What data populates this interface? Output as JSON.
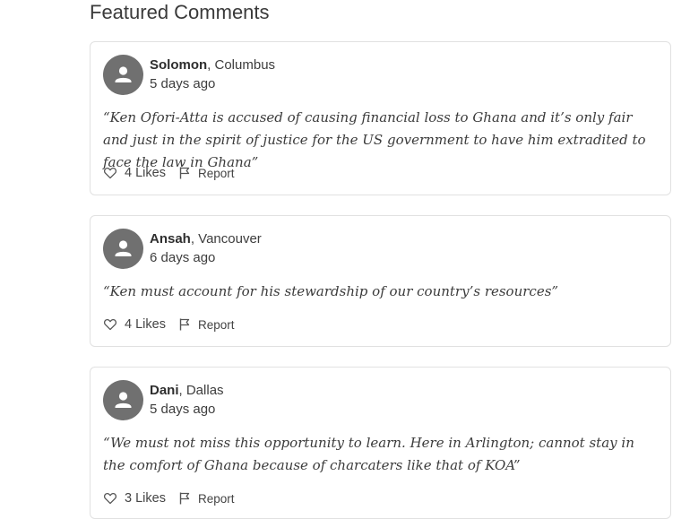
{
  "section": {
    "title": "Featured Comments"
  },
  "comments": [
    {
      "author": "Solomon",
      "location": ", Columbus",
      "time": "5 days ago",
      "text": "“Ken Ofori-Atta is accused of causing financial loss to Ghana and it’s only fair and just in the spirit of justice for the US government to have him extradited to face the law in Ghana”",
      "likes_label": "4 Likes",
      "report_label": "Report"
    },
    {
      "author": "Ansah",
      "location": ", Vancouver",
      "time": "6 days ago",
      "text": "“Ken must account for his stewardship of our country’s resources”",
      "likes_label": "4 Likes",
      "report_label": "Report"
    },
    {
      "author": "Dani",
      "location": ", Dallas",
      "time": "5 days ago",
      "text": "“We must not miss this opportunity to learn. Here in Arlington; cannot stay in the comfort of Ghana because of charcaters like that of KOA”",
      "likes_label": "3 Likes",
      "report_label": "Report"
    }
  ],
  "icons": {
    "avatar": "user-icon",
    "like": "heart-icon",
    "report": "flag-icon"
  }
}
